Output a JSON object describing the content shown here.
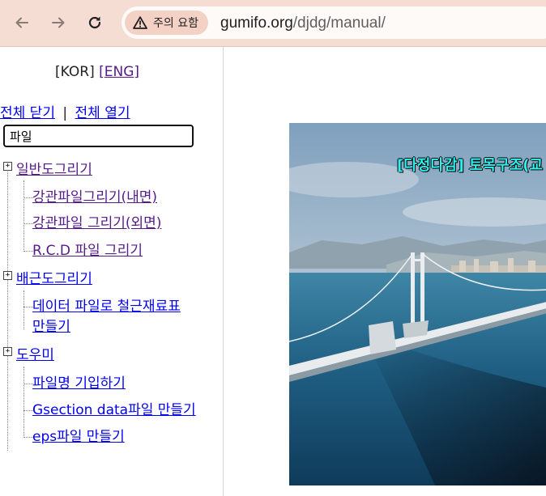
{
  "browser": {
    "security_chip": "주의 요함",
    "url_host": "gumifo.org",
    "url_path": "/djdg/manual/"
  },
  "toc": {
    "lang_kor": "KOR",
    "lang_eng": "ENG",
    "collapse_all": "전체 닫기",
    "separator": "|",
    "expand_all": "전체 열기",
    "search_value": "파일",
    "sections": [
      {
        "label": "일반도그리기",
        "items": [
          "강관파일그리기(내면)",
          "강관파일 그리기(외면)",
          "R.C.D 파일 그리기"
        ]
      },
      {
        "label": "배근도그리기",
        "items": [
          "데이터 파일로 철근재료표",
          "만들기"
        ]
      },
      {
        "label": "도우미",
        "items": [
          "파일명 기입하기",
          "Gsection data파일 만들기",
          "eps파일 만들기"
        ]
      }
    ]
  },
  "content": {
    "photo_title": "[다정다감] 토목구조(교"
  },
  "colors": {
    "chrome": "#f6ddd3",
    "visited_link": "#551a8b",
    "link": "#0000ee",
    "title_cyan": "#2ff0f0"
  }
}
